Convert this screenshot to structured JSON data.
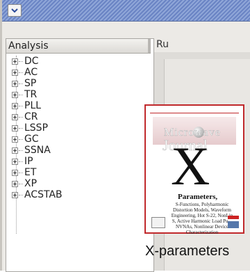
{
  "window": {
    "menu_icon": "chevron-down-icon"
  },
  "tree": {
    "header": "Analysis",
    "items": [
      {
        "label": "DC"
      },
      {
        "label": "AC"
      },
      {
        "label": "SP"
      },
      {
        "label": "TR"
      },
      {
        "label": "PLL"
      },
      {
        "label": "CR"
      },
      {
        "label": "LSSP"
      },
      {
        "label": "GC"
      },
      {
        "label": "SSNA"
      },
      {
        "label": "IP"
      },
      {
        "label": "ET"
      },
      {
        "label": "XP"
      },
      {
        "label": "ACSTAB"
      }
    ]
  },
  "right_panel": {
    "truncated_label": "Ru"
  },
  "magazine": {
    "title_line1": "Microwave",
    "title_line2": "Journal",
    "cover_letter": "X",
    "cover_heading": "Parameters,",
    "cover_description": "S-Functions, Polyharmonic Distortion Models, Waveform Engineering, Hot S-22, NonLin S, Active Harmonic Load Pull, NVNAs, Nonlinear Device Characterization",
    "accent_color": "#c0282b"
  },
  "caption": "X-parameters"
}
